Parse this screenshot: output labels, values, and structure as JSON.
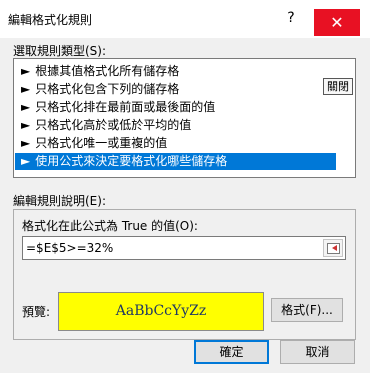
{
  "window": {
    "title": "編輯格式化規則",
    "help_label": "?",
    "close_label": "✕"
  },
  "rule_type": {
    "heading": "選取規則類型(S):",
    "items": [
      {
        "label": "根據其值格式化所有儲存格",
        "selected": false
      },
      {
        "label": "只格式化包含下列的儲存格",
        "selected": false
      },
      {
        "label": "只格式化排在最前面或最後面的值",
        "selected": false
      },
      {
        "label": "只格式化高於或低於平均的值",
        "selected": false
      },
      {
        "label": "只格式化唯一或重複的值",
        "selected": false
      },
      {
        "label": "使用公式來決定要格式化哪些儲存格",
        "selected": true
      }
    ],
    "tooltip": "關閉",
    "arrow": "►"
  },
  "rule_description": {
    "heading": "編輯規則說明(E):",
    "formula_label": "格式化在此公式為 True 的值(O):",
    "formula_value": "=$E$5>=32%",
    "preview_label": "預覽:",
    "preview_text": "AaBbCcYyZz",
    "preview_color": "#ffff00",
    "format_button": "格式(F)..."
  },
  "buttons": {
    "ok": "確定",
    "cancel": "取消"
  }
}
